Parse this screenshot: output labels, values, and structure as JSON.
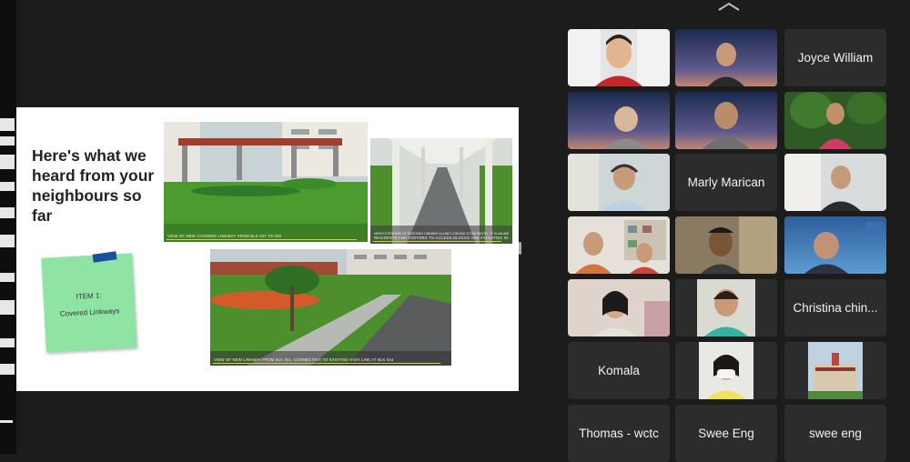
{
  "slide": {
    "title": "Here's what we heard from your neighbours so far",
    "note_line1": "ITEM 1:",
    "note_line2": "Covered Linkways",
    "photo1_caption": "VIEW OF NEW COVERED LINKWAY FROM BLK 037 TO 039",
    "photo2_caption_a": "NEW EXTENSION OF EXISTING LINKWAY ALONG LORONG 8 TOA PAYOH - IT IS AN AMENITY TO",
    "photo2_caption_b": "RESIDENTS AND VISITORS TO ACCESS BLOCKS AND FACILITIES IN THE ESTATE",
    "photo3_caption": "VIEW OF NEW LINKWAY FROM BLK 041, CONNECTING TO EXISTING HIGH LINK AT BLK 044"
  },
  "participants": [
    {
      "name": "",
      "kind": "video"
    },
    {
      "name": "",
      "kind": "video"
    },
    {
      "name": "Joyce William",
      "kind": "name"
    },
    {
      "name": "",
      "kind": "video"
    },
    {
      "name": "",
      "kind": "video"
    },
    {
      "name": "",
      "kind": "video"
    },
    {
      "name": "",
      "kind": "video"
    },
    {
      "name": "Marly Marican",
      "kind": "name"
    },
    {
      "name": "",
      "kind": "video"
    },
    {
      "name": "",
      "kind": "video"
    },
    {
      "name": "",
      "kind": "video"
    },
    {
      "name": "",
      "kind": "video"
    },
    {
      "name": "",
      "kind": "video"
    },
    {
      "name": "",
      "kind": "video"
    },
    {
      "name": "Christina chin...",
      "kind": "name"
    },
    {
      "name": "Komala",
      "kind": "name"
    },
    {
      "name": "",
      "kind": "video"
    },
    {
      "name": "",
      "kind": "video"
    },
    {
      "name": "Thomas - wctc",
      "kind": "name"
    },
    {
      "name": "Swee Eng",
      "kind": "name"
    },
    {
      "name": "swee eng",
      "kind": "name"
    }
  ],
  "colors": {
    "background": "#1c1c1c",
    "tile": "#2c2c2c",
    "active_speaker": "#49d06b",
    "note": "#8fe3a3"
  }
}
